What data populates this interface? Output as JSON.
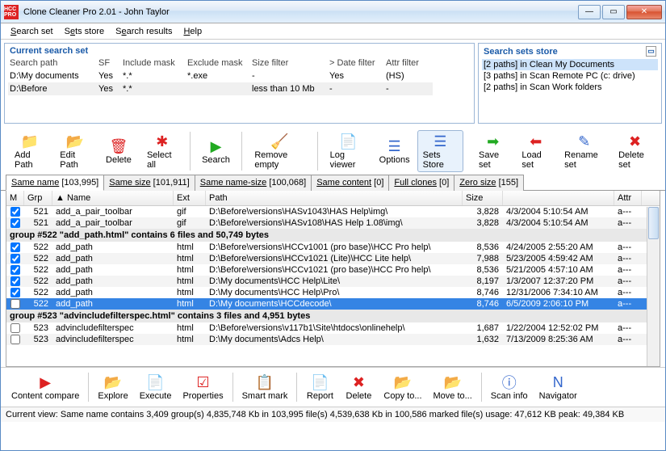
{
  "window": {
    "title": "Clone Cleaner Pro 2.01 - John Taylor",
    "icon_text": "HCC\nPRO"
  },
  "menu": [
    "Search set",
    "Sets store",
    "Search results",
    "Help"
  ],
  "menu_u": [
    "S",
    "e",
    "e",
    "H"
  ],
  "panel_left": {
    "title": "Current search set",
    "headers": [
      "Search path",
      "SF",
      "Include mask",
      "Exclude mask",
      "Size filter",
      "> Date filter",
      "Attr filter"
    ],
    "rows": [
      [
        "D:\\My documents",
        "Yes",
        "*.*",
        "*.exe",
        "-",
        "Yes",
        "(HS)"
      ],
      [
        "D:\\Before",
        "Yes",
        "*.*",
        "",
        "less than 10 Mb",
        "-",
        "-"
      ]
    ]
  },
  "panel_right": {
    "title": "Search sets store",
    "items": [
      "[2 paths] in Clean My Documents",
      "[3 paths] in Scan Remote PC (c: drive)",
      "[2 paths] in Scan Work folders"
    ]
  },
  "toolbar_top_left": [
    {
      "name": "add-path",
      "label": "Add Path",
      "glyph": "📁",
      "color": "#3a3"
    },
    {
      "name": "edit-path",
      "label": "Edit Path",
      "glyph": "📂",
      "color": "#c80"
    },
    {
      "name": "delete-path",
      "label": "Delete",
      "glyph": "🗑",
      "color": "#d22"
    },
    {
      "name": "select-all",
      "label": "Select all",
      "glyph": "✱",
      "color": "#d22"
    },
    {
      "name": "search",
      "label": "Search",
      "glyph": "▶",
      "color": "#2a2"
    },
    {
      "name": "remove-empty",
      "label": "Remove empty",
      "glyph": "🧹",
      "color": "#c80"
    },
    {
      "name": "log-viewer",
      "label": "Log viewer",
      "glyph": "📄",
      "color": "#36c"
    },
    {
      "name": "options",
      "label": "Options",
      "glyph": "☰",
      "color": "#36c"
    },
    {
      "name": "sets-store",
      "label": "Sets Store",
      "glyph": "☰",
      "color": "#36c",
      "sel": true
    }
  ],
  "toolbar_top_right": [
    {
      "name": "save-set",
      "label": "Save set",
      "glyph": "➡",
      "color": "#2a2"
    },
    {
      "name": "load-set",
      "label": "Load set",
      "glyph": "⬅",
      "color": "#d22"
    },
    {
      "name": "rename-set",
      "label": "Rename set",
      "glyph": "✎",
      "color": "#36c"
    },
    {
      "name": "delete-set",
      "label": "Delete set",
      "glyph": "✖",
      "color": "#d22"
    }
  ],
  "tabs": [
    {
      "label": "Same name [103,995]",
      "active": true
    },
    {
      "label": "Same size [101,911]"
    },
    {
      "label": "Same name-size [100,068]"
    },
    {
      "label": "Same content [0]"
    },
    {
      "label": "Full clones [0]"
    },
    {
      "label": "Zero size [155]"
    }
  ],
  "grid_headers": [
    "M",
    "Grp",
    "Name",
    "Ext",
    "Path",
    "Size",
    "",
    "Attr"
  ],
  "grid_sort_col": "Name",
  "rows": [
    {
      "type": "r",
      "chk": true,
      "grp": "521",
      "name": "add_a_pair_toolbar",
      "ext": "gif",
      "path": "D:\\Before\\versions\\HASv1043\\HAS Help\\img\\",
      "size": "3,828",
      "date": "4/3/2004 5:10:54 AM",
      "attr": "a---",
      "alt": false
    },
    {
      "type": "r",
      "chk": true,
      "grp": "521",
      "name": "add_a_pair_toolbar",
      "ext": "gif",
      "path": "D:\\Before\\versions\\HASv108\\HAS Help 1.08\\img\\",
      "size": "3,828",
      "date": "4/3/2004 5:10:54 AM",
      "attr": "a---",
      "alt": true
    },
    {
      "type": "g",
      "text": "group #522 \"add_path.html\" contains 6 files and 50,749 bytes"
    },
    {
      "type": "r",
      "chk": true,
      "grp": "522",
      "name": "add_path",
      "ext": "html",
      "path": "D:\\Before\\versions\\HCCv1001 (pro base)\\HCC Pro help\\",
      "size": "8,536",
      "date": "4/24/2005 2:55:20 AM",
      "attr": "a---",
      "alt": false
    },
    {
      "type": "r",
      "chk": true,
      "grp": "522",
      "name": "add_path",
      "ext": "html",
      "path": "D:\\Before\\versions\\HCCv1021 (Lite)\\HCC Lite help\\",
      "size": "7,988",
      "date": "5/23/2005 4:59:42 AM",
      "attr": "a---",
      "alt": true
    },
    {
      "type": "r",
      "chk": true,
      "grp": "522",
      "name": "add_path",
      "ext": "html",
      "path": "D:\\Before\\versions\\HCCv1021 (pro base)\\HCC Pro help\\",
      "size": "8,536",
      "date": "5/21/2005 4:57:10 AM",
      "attr": "a---",
      "alt": false
    },
    {
      "type": "r",
      "chk": true,
      "grp": "522",
      "name": "add_path",
      "ext": "html",
      "path": "D:\\My documents\\HCC Help\\Lite\\",
      "size": "8,197",
      "date": "1/3/2007 12:37:20 PM",
      "attr": "a---",
      "alt": true
    },
    {
      "type": "r",
      "chk": true,
      "grp": "522",
      "name": "add_path",
      "ext": "html",
      "path": "D:\\My documents\\HCC Help\\Pro\\",
      "size": "8,746",
      "date": "12/31/2006 7:34:10 AM",
      "attr": "a---",
      "alt": false
    },
    {
      "type": "r",
      "chk": false,
      "grp": "522",
      "name": "add_path",
      "ext": "html",
      "path": "D:\\My documents\\HCCdecode\\",
      "size": "8,746",
      "date": "6/5/2009 2:06:10 PM",
      "attr": "a---",
      "sel": true
    },
    {
      "type": "g",
      "text": "group #523 \"advincludefilterspec.html\" contains 3 files and 4,951 bytes"
    },
    {
      "type": "r",
      "chk": false,
      "grp": "523",
      "name": "advincludefilterspec",
      "ext": "html",
      "path": "D:\\Before\\versions\\v117b1\\Site\\htdocs\\onlinehelp\\",
      "size": "1,687",
      "date": "1/22/2004 12:52:02 PM",
      "attr": "a---",
      "alt": false
    },
    {
      "type": "r",
      "chk": false,
      "grp": "523",
      "name": "advincludefilterspec",
      "ext": "html",
      "path": "D:\\My documents\\Adcs Help\\",
      "size": "1,632",
      "date": "7/13/2009 8:25:36 AM",
      "attr": "a---",
      "alt": true
    }
  ],
  "toolbar_bottom": [
    {
      "name": "content-compare",
      "label": "Content compare",
      "glyph": "▶",
      "color": "#d22"
    },
    {
      "name": "explore",
      "label": "Explore",
      "glyph": "📂",
      "color": "#c80"
    },
    {
      "name": "execute",
      "label": "Execute",
      "glyph": "📄",
      "color": "#36c"
    },
    {
      "name": "properties",
      "label": "Properties",
      "glyph": "☑",
      "color": "#d22"
    },
    {
      "name": "smart-mark",
      "label": "Smart mark",
      "glyph": "📋",
      "color": "#c80"
    },
    {
      "name": "report",
      "label": "Report",
      "glyph": "📄",
      "color": "#36c"
    },
    {
      "name": "delete-file",
      "label": "Delete",
      "glyph": "✖",
      "color": "#d22"
    },
    {
      "name": "copy-to",
      "label": "Copy to...",
      "glyph": "📂",
      "color": "#c80"
    },
    {
      "name": "move-to",
      "label": "Move to...",
      "glyph": "📂",
      "color": "#c80"
    },
    {
      "name": "scan-info",
      "label": "Scan info",
      "glyph": "ⓘ",
      "color": "#36c"
    },
    {
      "name": "navigator",
      "label": "Navigator",
      "glyph": "N",
      "color": "#36c"
    }
  ],
  "status": "Current view: Same name contains 3,409 group(s)   4,835,748 Kb in 103,995 file(s)   4,539,638 Kb in 100,586 marked file(s) usage: 47,612 KB peak: 49,384 KB"
}
